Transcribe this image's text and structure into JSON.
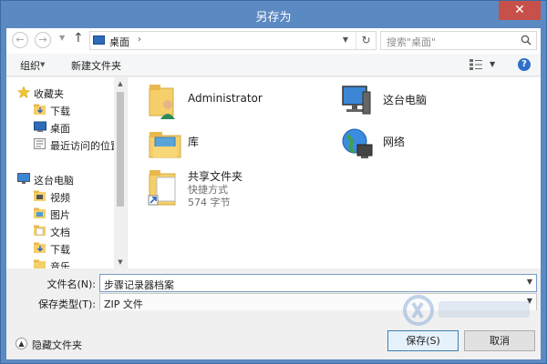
{
  "window": {
    "title": "另存为",
    "close_glyph": "✕"
  },
  "address": {
    "location": "桌面",
    "search_placeholder": "搜索\"桌面\""
  },
  "toolbar": {
    "organize_label": "组织",
    "new_folder_label": "新建文件夹",
    "help_glyph": "?"
  },
  "sidebar": {
    "items": [
      {
        "label": "收藏夹",
        "icon": "star-icon"
      },
      {
        "label": "下载",
        "icon": "download-folder-icon"
      },
      {
        "label": "桌面",
        "icon": "desktop-icon"
      },
      {
        "label": "最近访问的位置",
        "icon": "recent-places-icon"
      },
      {
        "label": "这台电脑",
        "icon": "computer-icon"
      },
      {
        "label": "视频",
        "icon": "videos-folder-icon"
      },
      {
        "label": "图片",
        "icon": "pictures-folder-icon"
      },
      {
        "label": "文档",
        "icon": "documents-folder-icon"
      },
      {
        "label": "下载",
        "icon": "download-folder-icon"
      },
      {
        "label": "音乐",
        "icon": "music-folder-icon"
      }
    ]
  },
  "content": {
    "items": [
      {
        "name": "Administrator",
        "icon": "user-folder-icon"
      },
      {
        "name": "这台电脑",
        "icon": "computer-icon"
      },
      {
        "name": "库",
        "icon": "library-icon"
      },
      {
        "name": "网络",
        "icon": "network-icon"
      },
      {
        "name": "共享文件夹",
        "sub1": "快捷方式",
        "sub2": "574 字节",
        "icon": "shortcut-folder-icon"
      }
    ]
  },
  "fields": {
    "filename_label": "文件名(N):",
    "filename_value": "步骤记录器档案",
    "filetype_label": "保存类型(T):",
    "filetype_value": "ZIP 文件"
  },
  "footer": {
    "hide_folders_label": "隐藏文件夹",
    "save_label": "保存(S)",
    "cancel_label": "取消"
  },
  "colors": {
    "titlebar": "#5b89c2",
    "close": "#c7504a",
    "accent": "#2f6fc7"
  }
}
